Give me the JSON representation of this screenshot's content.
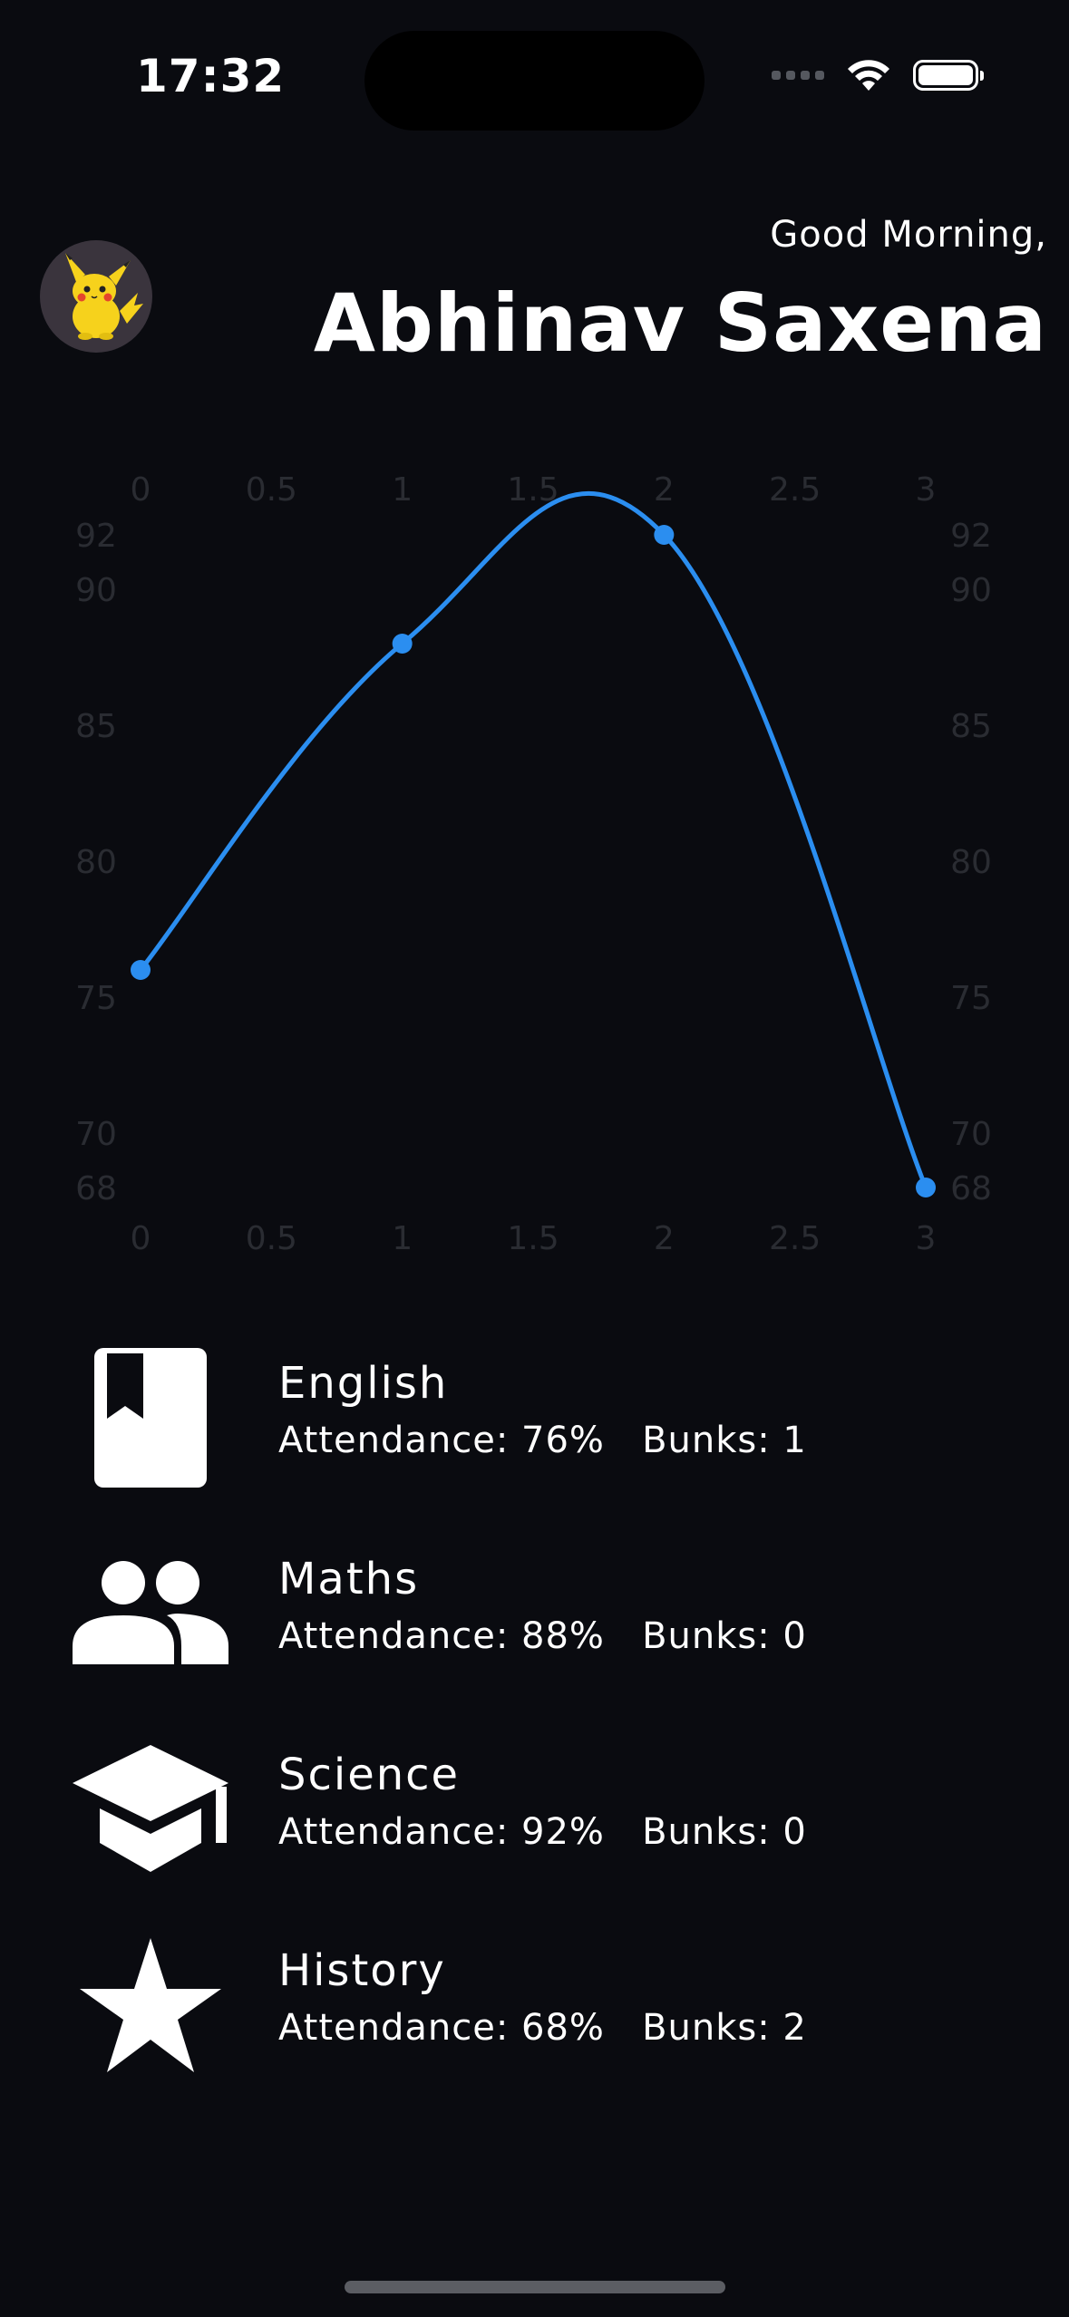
{
  "status_bar": {
    "time": "17:32"
  },
  "header": {
    "greeting": "Good Morning,",
    "name": "Abhinav Saxena",
    "avatar_icon": "pikachu-avatar"
  },
  "colors": {
    "background": "#0a0b10",
    "accent": "#2b8ef0",
    "tick_label": "#2a2c32"
  },
  "chart_data": {
    "type": "line",
    "smooth": true,
    "x": [
      0,
      1,
      2,
      3
    ],
    "values": [
      76,
      88,
      92,
      68
    ],
    "xlim": [
      0,
      3
    ],
    "ylim": [
      68,
      92
    ],
    "x_ticks": [
      "0",
      "0.5",
      "1",
      "1.5",
      "2",
      "2.5",
      "3"
    ],
    "y_ticks": [
      "92",
      "90",
      "85",
      "80",
      "75",
      "70",
      "68"
    ],
    "x_tick_values": [
      0,
      0.5,
      1,
      1.5,
      2,
      2.5,
      3
    ],
    "y_tick_values": [
      92,
      90,
      85,
      80,
      75,
      70,
      68
    ],
    "axes": "x ticks on top and bottom, y ticks on left and right",
    "grid": false
  },
  "subjects": [
    {
      "name": "English",
      "stats": "Attendance: 76%   Bunks: 1",
      "icon": "book-bookmark-icon"
    },
    {
      "name": "Maths",
      "stats": "Attendance: 88%   Bunks: 0",
      "icon": "people-icon"
    },
    {
      "name": "Science",
      "stats": "Attendance: 92%   Bunks: 0",
      "icon": "graduation-cap-icon"
    },
    {
      "name": "History",
      "stats": "Attendance: 68%   Bunks: 2",
      "icon": "star-icon"
    }
  ]
}
